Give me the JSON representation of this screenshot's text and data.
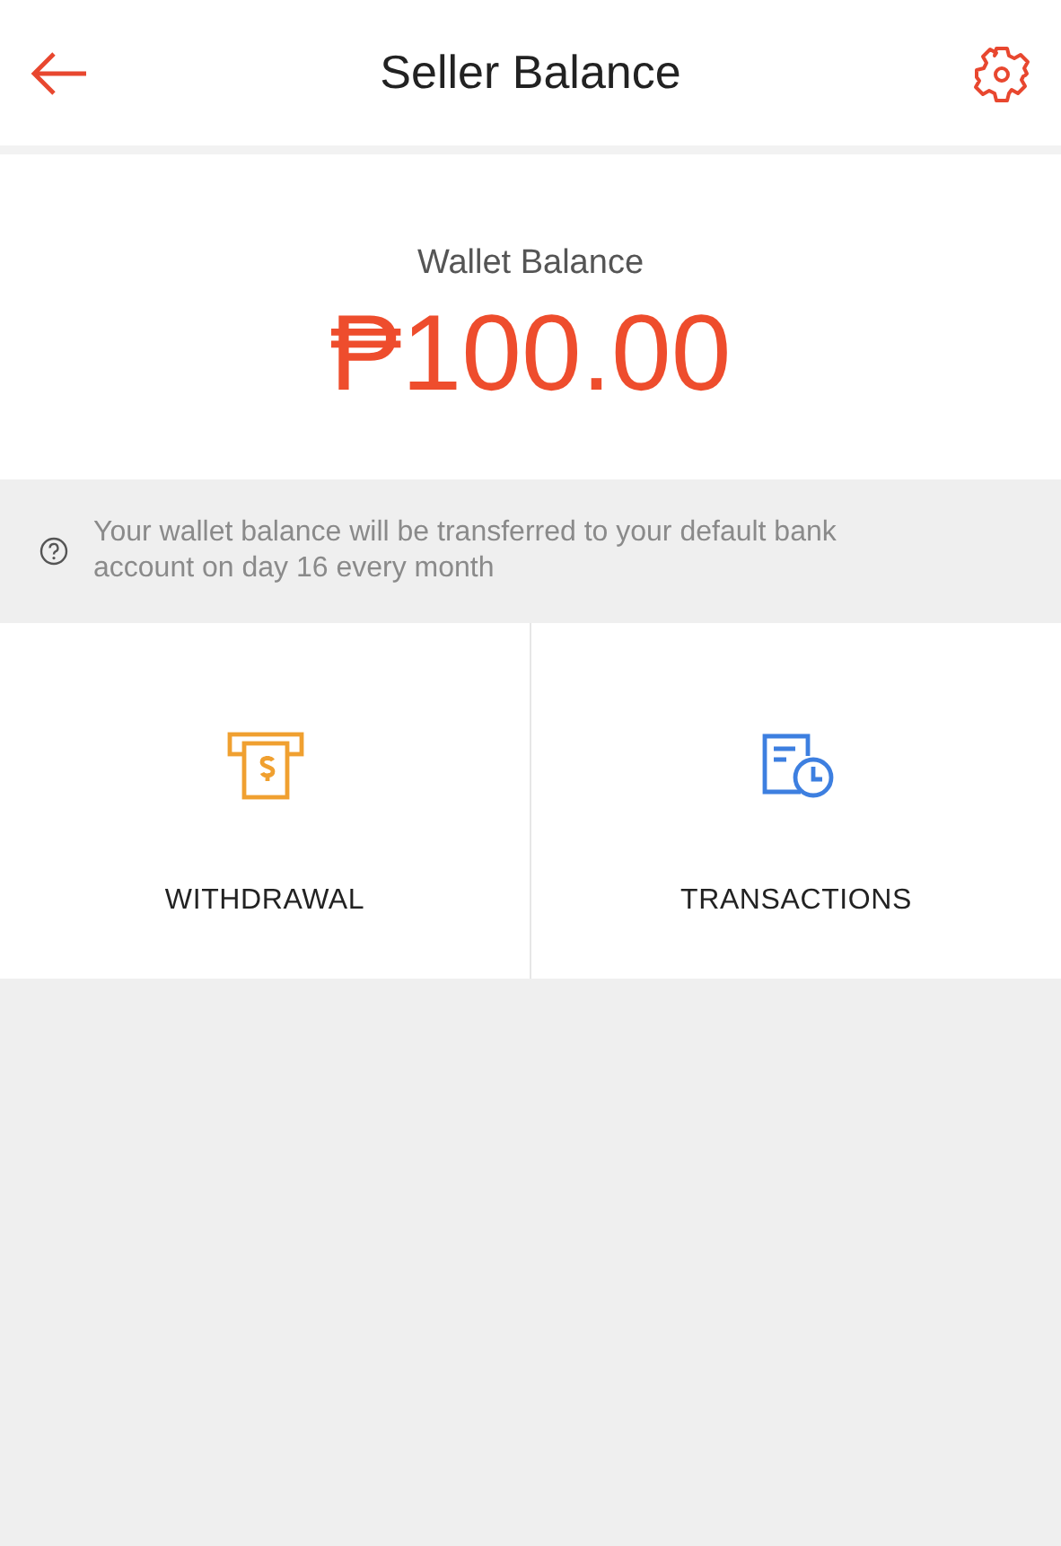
{
  "header": {
    "title": "Seller Balance"
  },
  "balance": {
    "label": "Wallet Balance",
    "amount": "₱100.00"
  },
  "notice": {
    "text": "Your wallet balance will be transferred to your default bank account on day 16 every month"
  },
  "actions": [
    {
      "kind": "withdrawal",
      "label": "WITHDRAWAL"
    },
    {
      "kind": "transactions",
      "label": "TRANSACTIONS"
    }
  ]
}
